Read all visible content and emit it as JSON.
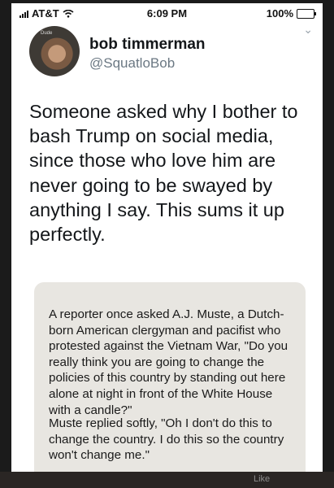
{
  "status_bar": {
    "carrier": "AT&T",
    "time": "6:09 PM",
    "battery": "100%",
    "battery_level": 1.0
  },
  "user": {
    "name": "bob timmerman",
    "handle": "@SquatloBob"
  },
  "tweet": {
    "text": "Someone asked why I bother to bash Trump on social media, since those who love him are never going to be swayed by anything I say. This sums it up perfectly."
  },
  "quote_card": {
    "paragraph1": "A reporter once asked A.J. Muste, a Dutch-born American clergyman and pacifist who protested against the Vietnam War, \"Do you really think you are going to change the policies of this country by standing out here alone at night in front of the White House with a candle?\"",
    "paragraph2": "Muste replied softly, \"Oh I don't do this to change the country. I do this so the country won't change me.\""
  },
  "footer": {
    "like_label": "Like"
  },
  "icons": {
    "chevron": "chevron-down-icon",
    "wifi": "wifi-icon",
    "signal": "signal-icon",
    "battery": "battery-icon"
  }
}
